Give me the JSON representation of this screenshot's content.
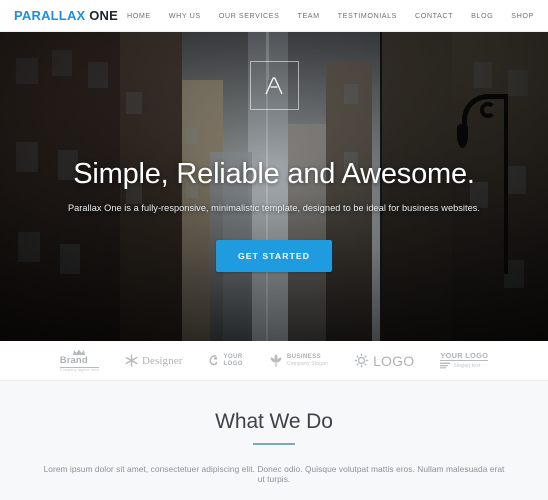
{
  "header": {
    "logo": {
      "primary": "PARALLAX",
      "secondary": "ONE"
    },
    "nav": [
      {
        "label": "HOME"
      },
      {
        "label": "WHY US"
      },
      {
        "label": "OUR SERVICES"
      },
      {
        "label": "TEAM"
      },
      {
        "label": "TESTIMONIALS"
      },
      {
        "label": "CONTACT"
      },
      {
        "label": "BLOG"
      },
      {
        "label": "SHOP"
      }
    ]
  },
  "hero": {
    "title": "Simple, Reliable and Awesome.",
    "subtitle": "Parallax One is a fully-responsive, minimalistic template, designed to be ideal for business websites.",
    "cta_label": "GET STARTED",
    "badge_icon": "lambda-logo-icon",
    "accent_color": "#1f9bdf"
  },
  "clients": [
    {
      "name": "Brand",
      "tagline": "Company tagline here",
      "mark": "crown-icon"
    },
    {
      "name": "Designer",
      "tagline": "",
      "mark": "snowflake-icon"
    },
    {
      "name": "YOUR",
      "name2": "LOGO",
      "tagline": "",
      "mark": "swirl-icon"
    },
    {
      "name": "BUSINESS",
      "tagline": "Company Slogan",
      "mark": "leaf-icon"
    },
    {
      "name": "LOGO",
      "tagline": "",
      "mark": "gear-sun-icon"
    },
    {
      "name": "YOUR LOGO",
      "tagline": "Slogan text",
      "mark": "lines-icon"
    }
  ],
  "what_we_do": {
    "title": "What We Do",
    "body": "Lorem ipsum dolor sit amet, consectetuer adipiscing elit. Donec odio. Quisque volutpat mattis eros. Nullam malesuada erat ut turpis.",
    "underline_color": "#7fa8bc"
  }
}
